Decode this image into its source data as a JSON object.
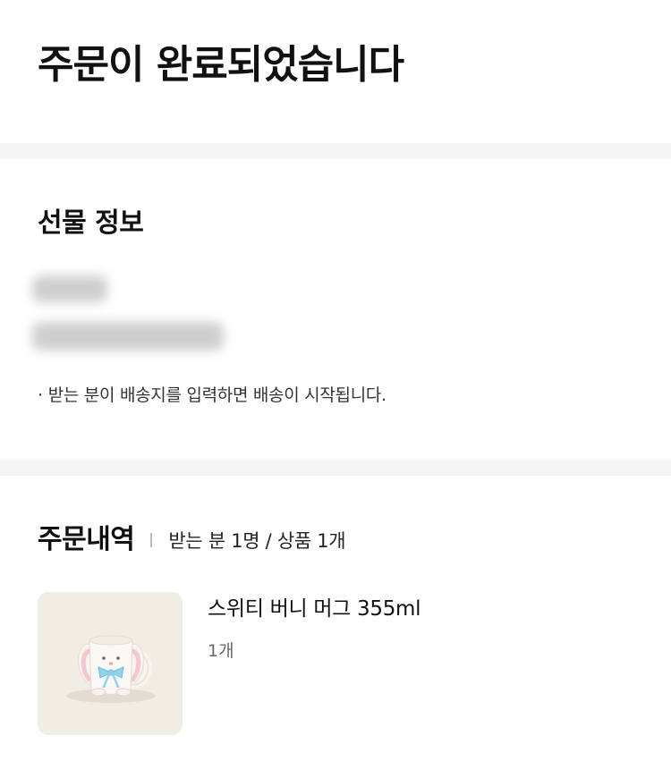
{
  "header": {
    "title": "주문이 완료되었습니다"
  },
  "gift_info": {
    "title": "선물 정보",
    "note_bullet": "·",
    "note": "받는 분이 배송지를 입력하면 배송이 시작됩니다."
  },
  "order": {
    "title": "주문내역",
    "summary": "받는 분 1명 / 상품 1개",
    "items": [
      {
        "name": "스위티 버니 머그 355ml",
        "quantity": "1개",
        "image_icon": "bunny-mug"
      }
    ]
  },
  "colors": {
    "section_divider": "#f5f5f5",
    "thumb_bg": "#f0ede4",
    "ribbon": "#8fd3e8",
    "ear_pink": "#f4c6cf"
  }
}
